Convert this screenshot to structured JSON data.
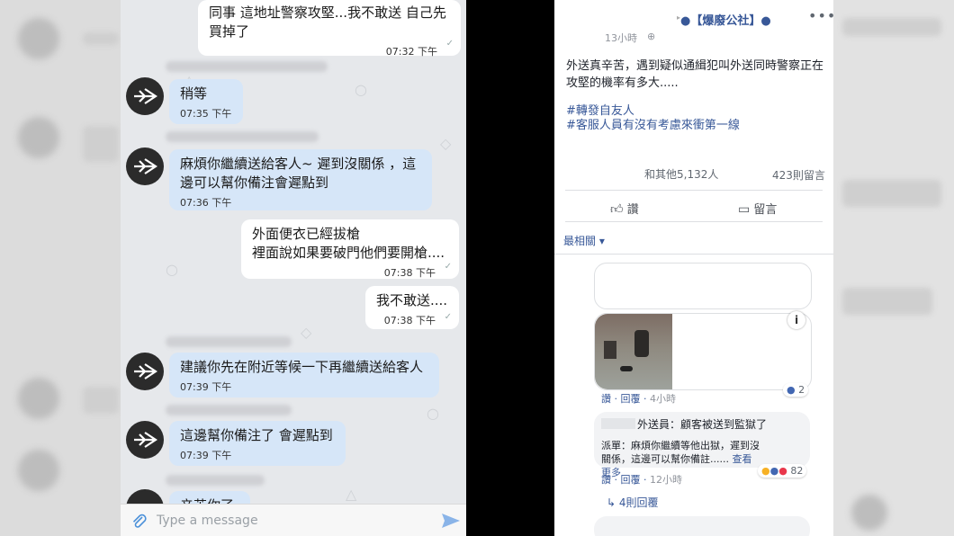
{
  "chat": {
    "messages": [
      {
        "dir": "out",
        "text": "同事 這地址警察攻堅...我不敢送 自己先\n買掉了",
        "time": "07:32 下午"
      },
      {
        "dir": "in",
        "text": "稍等",
        "time": "07:35 下午"
      },
      {
        "dir": "in",
        "text": "麻煩你繼續送給客人~ 遲到沒關係 ，這\n邊可以幫你備注會遲點到",
        "time": "07:36 下午"
      },
      {
        "dir": "out",
        "text": "外面便衣已經拔槍\n裡面說如果要破門他們要開槍....",
        "time": "07:38 下午"
      },
      {
        "dir": "out",
        "text": "我不敢送....",
        "time": "07:38 下午"
      },
      {
        "dir": "in",
        "text": "建議你先在附近等候一下再繼續送給客人",
        "time": "07:39 下午"
      },
      {
        "dir": "in",
        "text": "這邊幫你備注了 會遲點到",
        "time": "07:39 下午"
      }
    ],
    "partial_text": "辛苦你了",
    "input_placeholder": "Type a message"
  },
  "post": {
    "page_name": "●【爆廢公社】●",
    "time": "13小時",
    "text": "外送真辛苦，遇到疑似通緝犯叫外送同時警察正在攻堅的機率有多大.....",
    "hashtags": [
      "#轉發自友人",
      "#客服人員有沒有考慮來衝第一線"
    ],
    "likes": "和其他5,132人",
    "comments_count": "423則留言",
    "like_label": "讚",
    "comment_label": "留言",
    "sort_label": "最相關",
    "comment1_actions": {
      "like": "讚",
      "reply": "回覆",
      "time": "4小時",
      "reactions": "2"
    },
    "comment2": {
      "line1": "外送員：顧客被送到監獄了",
      "line2": "派單：麻煩你繼續等他出獄，遲到沒關係，這邊可以幫你備註......",
      "see_more": "查看更多",
      "reactions": "82"
    },
    "comment2_actions": {
      "like": "讚",
      "reply": "回覆",
      "time": "12小時"
    },
    "replies": "4則回覆",
    "colors": {
      "link": "#385898",
      "bubble_in": "#d6e6f8",
      "bubble_out": "#ffffff"
    }
  }
}
